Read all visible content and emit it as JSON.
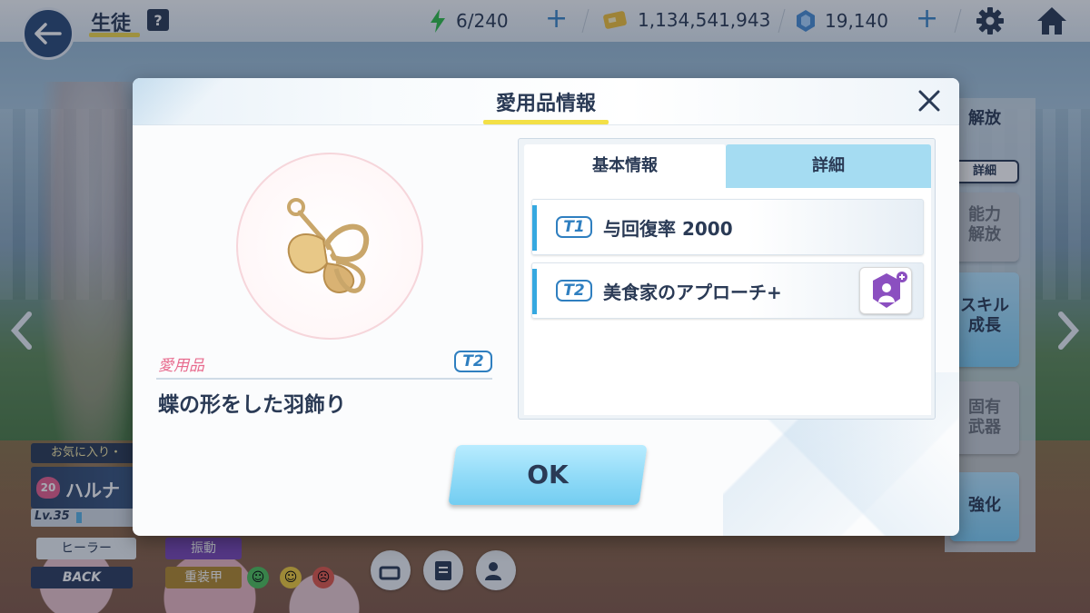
{
  "header": {
    "title": "生徒",
    "help": "?",
    "stamina": "6/240",
    "credits": "1,134,541,943",
    "pyroxene": "19,140",
    "plus_glyph": "+"
  },
  "sidebar_right": {
    "unlock_top": "解放",
    "detail": "詳細",
    "ability_unlock": "能力\n解放",
    "skill_growth": "スキル\n成長",
    "unique_weapon": "固有\n武器",
    "enhance": "強化"
  },
  "student": {
    "favorite": "お気に入り・",
    "bond_level": "20",
    "name": "ハルナ",
    "level": "Lv.35",
    "role": "ヒーラー",
    "attack_type": "振動",
    "position": "BACK",
    "armor_type": "重装甲"
  },
  "modal": {
    "title": "愛用品情報",
    "item_category": "愛用品",
    "item_tier": "T2",
    "item_name": "蝶の形をした羽飾り",
    "tabs": [
      {
        "label": "基本情報",
        "active": true
      },
      {
        "label": "詳細",
        "active": false
      }
    ],
    "rows": [
      {
        "tier": "T1",
        "text": "与回復率 2000"
      },
      {
        "tier": "T2",
        "text": "美食家のアプローチ+"
      }
    ],
    "ok_label": "OK"
  },
  "colors": {
    "accent_blue": "#35a8e0",
    "title_underline": "#f3e047",
    "category_pink": "#e86b8e",
    "tab_inactive": "#a5dcf2",
    "navy_text": "#2a3a55"
  }
}
